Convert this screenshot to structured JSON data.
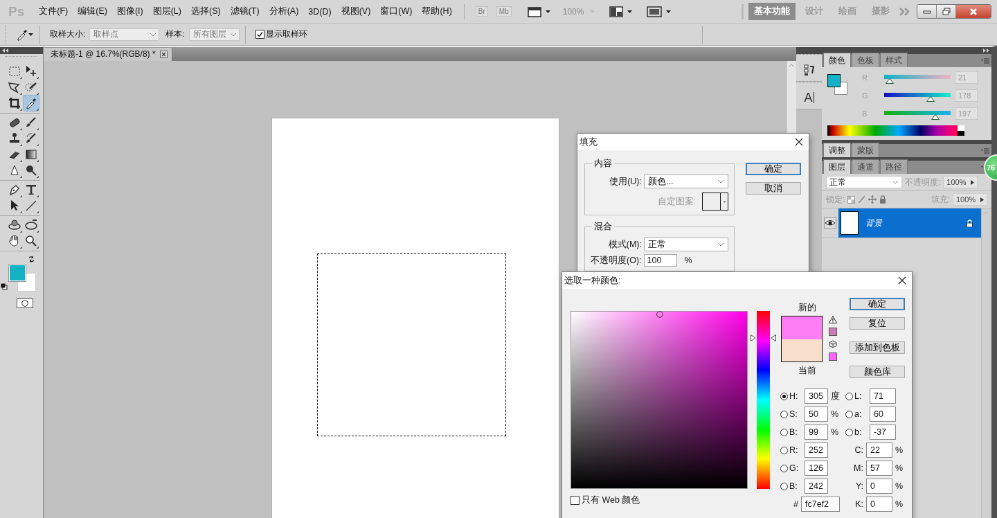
{
  "menubar": {
    "logo": "Ps",
    "menus": [
      "文件(F)",
      "编辑(E)",
      "图像(I)",
      "图层(L)",
      "选择(S)",
      "滤镜(T)",
      "分析(A)",
      "3D(D)",
      "视图(V)",
      "窗口(W)",
      "帮助(H)"
    ],
    "app_buttons": [
      {
        "label": "Br",
        "disabled": true
      },
      {
        "label": "Mb",
        "disabled": true
      }
    ],
    "zoom": {
      "value": "100%",
      "disabled": true
    },
    "workspaces": [
      {
        "label": "基本功能",
        "selected": true
      },
      {
        "label": "设计",
        "selected": false
      },
      {
        "label": "绘画",
        "selected": false
      },
      {
        "label": "摄影",
        "selected": false
      }
    ]
  },
  "options_bar": {
    "sample_size": {
      "label": "取样大小:",
      "value": "取样点"
    },
    "sample": {
      "label": "样本:",
      "value": "所有图层"
    },
    "show_ring": {
      "label": "显示取样环",
      "checked": true
    }
  },
  "tools": [
    {
      "selected": false
    },
    {
      "selected": false
    },
    {
      "selected": false
    },
    {
      "selected": false
    },
    {
      "selected": false
    },
    {
      "selected": true
    },
    {
      "selected": false
    },
    {
      "selected": false
    },
    {
      "selected": false
    },
    {
      "selected": false
    },
    {
      "selected": false
    },
    {
      "selected": false
    },
    {
      "selected": false
    },
    {
      "selected": false
    },
    {
      "selected": false
    },
    {
      "selected": false
    },
    {
      "selected": false
    },
    {
      "selected": false
    },
    {
      "selected": false
    },
    {
      "selected": false
    },
    {
      "selected": false
    },
    {
      "selected": false
    }
  ],
  "document": {
    "tab": {
      "title": "未标题-1 @ 16.7%(RGB/8) *",
      "selected": true
    }
  },
  "dock": [
    {
      "kind": "history"
    },
    {
      "kind": "character",
      "glyph": "A"
    }
  ],
  "color_panel": {
    "tabs": [
      {
        "label": "颜色",
        "selected": true
      },
      {
        "label": "色板",
        "selected": false
      },
      {
        "label": "样式",
        "selected": false
      }
    ],
    "channels": [
      {
        "name": "R",
        "level": 0.082,
        "reading": "21"
      },
      {
        "name": "G",
        "level": 0.698,
        "reading": "178"
      },
      {
        "name": "B",
        "level": 0.773,
        "reading": "197"
      }
    ]
  },
  "adjustments_panel": {
    "tabs": [
      {
        "label": "调整",
        "selected": true
      },
      {
        "label": "蒙版",
        "selected": false
      }
    ]
  },
  "layers_panel": {
    "tabs": [
      {
        "label": "图层",
        "selected": true
      },
      {
        "label": "通道",
        "selected": false
      },
      {
        "label": "路径",
        "selected": false
      }
    ],
    "blend_mode": "正常",
    "opacity": {
      "label": "不透明度:",
      "value": "100%"
    },
    "lock_label": "锁定:",
    "fill": {
      "label": "填充:",
      "value": "100%"
    },
    "layers": [
      {
        "name": "背景",
        "visible": true,
        "selected": true,
        "locked": true
      }
    ]
  },
  "badge": "76",
  "fill_dialog": {
    "title": "填充",
    "contents": {
      "legend": "内容",
      "use": {
        "label": "使用(U):",
        "value": "颜色..."
      },
      "custom_pattern": {
        "label": "自定图案:",
        "disabled": true
      }
    },
    "blending": {
      "legend": "混合",
      "mode": {
        "label": "模式(M):",
        "value": "正常"
      },
      "opacity": {
        "label": "不透明度(O):",
        "value": "100",
        "unit": "%"
      }
    },
    "buttons": [
      {
        "label": "确定",
        "default": true
      },
      {
        "label": "取消",
        "default": false
      }
    ]
  },
  "color_picker": {
    "title": "选取一种颜色:",
    "hue_slider": {
      "level": 0.847
    },
    "new_label": "新的",
    "current_label": "当前",
    "buttons": [
      {
        "label": "确定",
        "default": true
      },
      {
        "label": "复位",
        "default": false
      },
      {
        "label": "添加到色板",
        "default": false
      },
      {
        "label": "颜色库",
        "default": false
      }
    ],
    "fields_left": [
      {
        "kind": "radio",
        "label": "H:",
        "value": "305",
        "unit": "度",
        "selected": true
      },
      {
        "kind": "radio",
        "label": "S:",
        "value": "50",
        "unit": "%",
        "selected": false
      },
      {
        "kind": "radio",
        "label": "B:",
        "value": "99",
        "unit": "%",
        "selected": false
      },
      {
        "kind": "radio",
        "label": "R:",
        "value": "252",
        "selected": false
      },
      {
        "kind": "radio",
        "label": "G:",
        "value": "126",
        "selected": false
      },
      {
        "kind": "radio",
        "label": "B:",
        "value": "242",
        "selected": false
      },
      {
        "kind": "plain",
        "label": "#",
        "value": "fc7ef2"
      }
    ],
    "fields_right": [
      {
        "kind": "radio",
        "label": "L:",
        "value": "71",
        "selected": false
      },
      {
        "kind": "radio",
        "label": "a:",
        "value": "60",
        "selected": false
      },
      {
        "kind": "radio",
        "label": "b:",
        "value": "-37",
        "selected": false
      },
      {
        "kind": "plain",
        "label": "C:",
        "value": "22",
        "unit": "%"
      },
      {
        "kind": "plain",
        "label": "M:",
        "value": "57",
        "unit": "%"
      },
      {
        "kind": "plain",
        "label": "Y:",
        "value": "0",
        "unit": "%"
      },
      {
        "kind": "plain",
        "label": "K:",
        "value": "0",
        "unit": "%"
      }
    ],
    "web_only": {
      "label": "只有 Web 颜色",
      "checked": false
    }
  }
}
